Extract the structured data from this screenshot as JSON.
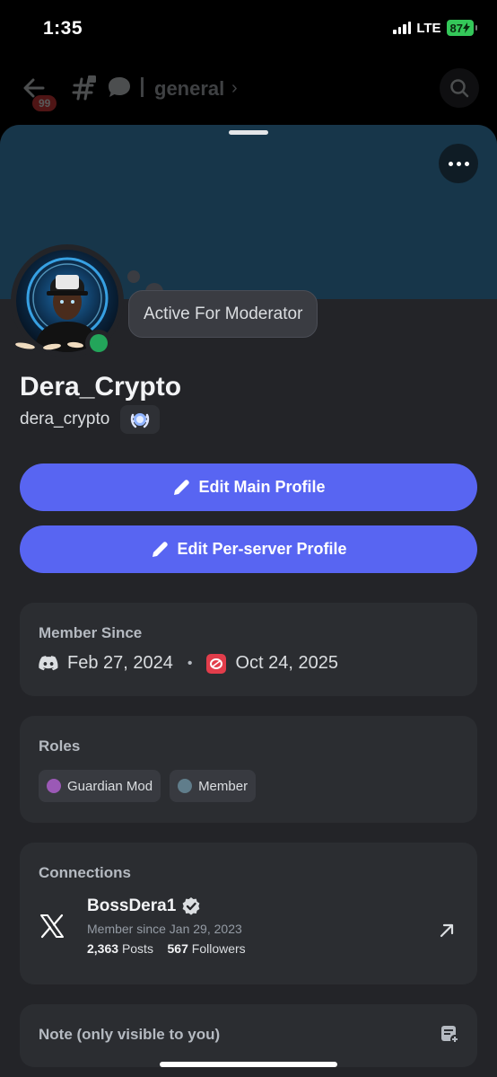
{
  "status_bar": {
    "time": "1:35",
    "network": "LTE",
    "battery": "87"
  },
  "channel_header": {
    "unread_count": "99",
    "channel_name": "general"
  },
  "profile": {
    "status_message": "Active For Moderator",
    "display_name": "Dera_Crypto",
    "username": "dera_crypto"
  },
  "actions": {
    "edit_main_label": "Edit Main Profile",
    "edit_server_label": "Edit Per-server Profile"
  },
  "member_since": {
    "title": "Member Since",
    "discord_date": "Feb 27, 2024",
    "separator": "•",
    "server_date": "Oct 24, 2025"
  },
  "roles": {
    "title": "Roles",
    "items": [
      {
        "label": "Guardian Mod",
        "color": "#9b59b6"
      },
      {
        "label": "Member",
        "color": "#607d8b"
      }
    ]
  },
  "connections": {
    "title": "Connections",
    "items": [
      {
        "icon": "x-logo-icon",
        "name": "BossDera1",
        "since": "Member since Jan 29, 2023",
        "posts_count": "2,363",
        "posts_label": "Posts",
        "followers_count": "567",
        "followers_label": "Followers"
      }
    ]
  },
  "note": {
    "placeholder": "Note (only visible to you)"
  },
  "colors": {
    "accent": "#5865f2",
    "online": "#23a55a",
    "banner": "#17364a"
  }
}
